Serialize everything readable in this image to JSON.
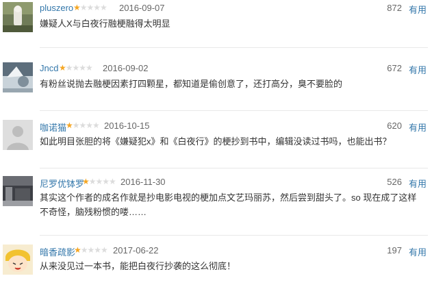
{
  "reviews": [
    {
      "username": "pluszero",
      "rating": 1,
      "rating_max": 5,
      "date": "2016-09-07",
      "votes": "872",
      "useful_label": "有用",
      "comment": "嫌疑人X与白夜行融梗融得太明显"
    },
    {
      "username": "Jncd",
      "rating": 1,
      "rating_max": 5,
      "date": "2016-09-02",
      "votes": "672",
      "useful_label": "有用",
      "comment": "有粉丝说抛去融梗因素打四颗星，都知道是偷创意了，还打高分，臭不要脸的"
    },
    {
      "username": "咖诺猫",
      "rating": 1,
      "rating_max": 5,
      "date": "2016-10-15",
      "votes": "620",
      "useful_label": "有用",
      "comment": "如此明目张胆的将《嫌疑犯x》和《白夜行》的梗抄到书中，编辑没读过书吗，也能出书？"
    },
    {
      "username": "尼罗优钵罗",
      "rating": 1,
      "rating_max": 5,
      "date": "2016-11-30",
      "votes": "526",
      "useful_label": "有用",
      "comment": "其实这个作者的成名作就是抄电影电视的梗加点文艺玛丽苏，然后尝到甜头了。so 现在成了这样不奇怪，脑残粉惯的喽……"
    },
    {
      "username": "暗香疏影",
      "rating": 1,
      "rating_max": 5,
      "date": "2017-06-22",
      "votes": "197",
      "useful_label": "有用",
      "comment": "从来没见过一本书，能把白夜行抄袭的这么彻底！"
    }
  ],
  "colors": {
    "link": "#3377aa",
    "star_on": "#f5a623",
    "star_off": "#dcdcdc",
    "meta": "#666666"
  },
  "icons": {
    "star_filled": "★",
    "star_empty": "★"
  }
}
